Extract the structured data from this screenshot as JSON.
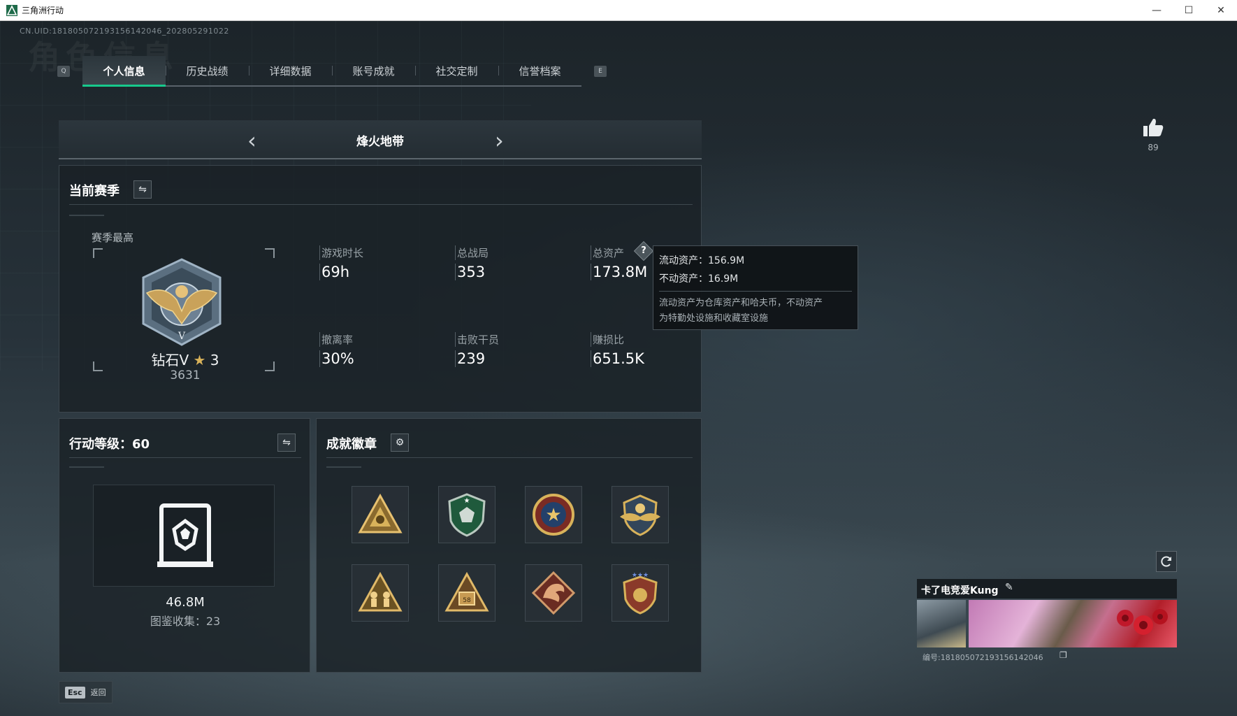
{
  "window": {
    "title": "三角洲行动",
    "minimize": "—",
    "maximize": "☐",
    "close": "✕"
  },
  "header": {
    "uid": "CN.UID:1818050721931561420​46_202805291022",
    "ghost_title": "角色信息"
  },
  "tabs": {
    "left_key": "Q",
    "right_key": "E",
    "items": [
      {
        "label": "个人信息",
        "active": true
      },
      {
        "label": "历史战绩",
        "active": false
      },
      {
        "label": "详细数据",
        "active": false
      },
      {
        "label": "账号成就",
        "active": false
      },
      {
        "label": "社交定制",
        "active": false
      },
      {
        "label": "信誉档案",
        "active": false
      }
    ]
  },
  "mode": {
    "title": "烽火地带",
    "prev": "‹",
    "next": "›"
  },
  "season": {
    "title": "当前赛季",
    "best_label": "赛季最高",
    "rank_name": "钻石V",
    "rank_stars": "3",
    "rank_score": "3631",
    "stats": [
      {
        "label": "游戏时长",
        "value": "69h"
      },
      {
        "label": "总战局",
        "value": "353"
      },
      {
        "label": "总资产",
        "value": "173.8M"
      },
      {
        "label": "撤离率",
        "value": "30%"
      },
      {
        "label": "击败干员",
        "value": "239"
      },
      {
        "label": "赚损比",
        "value": "651.5K"
      }
    ]
  },
  "tooltip": {
    "liquid": "流动资产：156.9M",
    "fixed": "不动资产：16.9M",
    "desc_line1": "流动资产为仓库资产和哈夫币，不动资产",
    "desc_line2": "为特勤处设施和收藏室设施"
  },
  "level": {
    "title": "行动等级：60",
    "value": "46.8M",
    "collection": "图鉴收集：23"
  },
  "achievements": {
    "title": "成就徽章",
    "badges": [
      "triangle-badge-icon",
      "shield-badge-icon",
      "star-badge-icon",
      "wings-badge-icon",
      "soldiers-badge-icon",
      "box-badge-icon",
      "dragon-badge-icon",
      "crest-badge-icon"
    ]
  },
  "likes": {
    "count": "89"
  },
  "card": {
    "name": "卡了电竞爱Kung",
    "id": "编号:18180507219315614204​6"
  },
  "footer": {
    "esc_key": "Esc",
    "esc_label": "返回"
  },
  "colors": {
    "accent": "#17c98c",
    "gold": "#d8b25a"
  }
}
